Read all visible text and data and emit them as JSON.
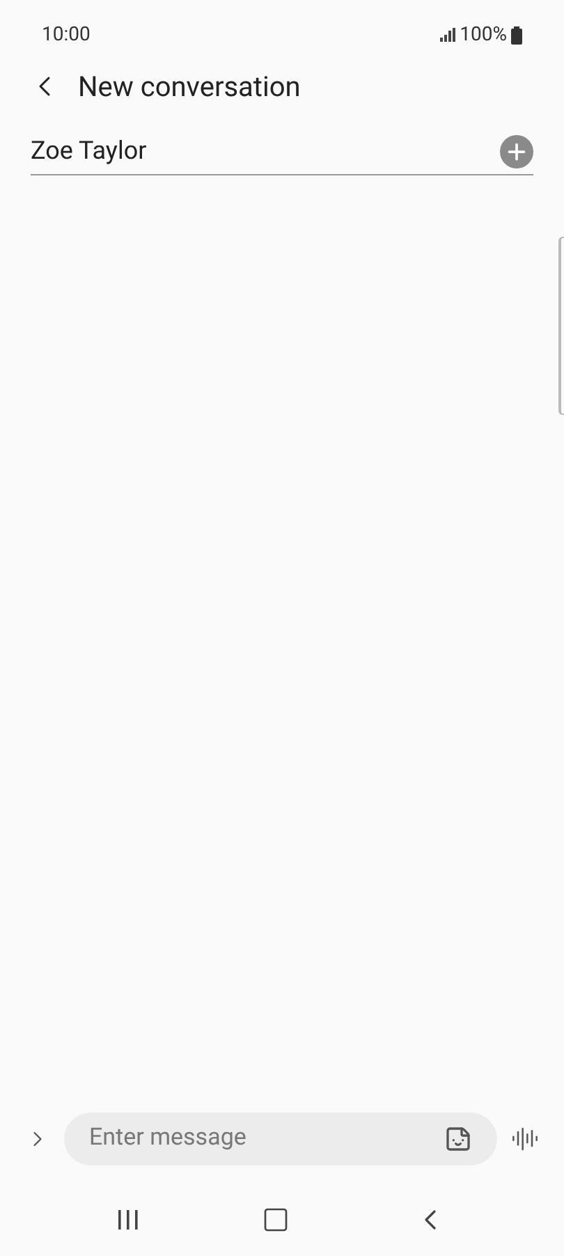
{
  "status_bar": {
    "time": "10:00",
    "battery": "100%"
  },
  "header": {
    "title": "New conversation"
  },
  "recipient": {
    "value": "Zoe Taylor"
  },
  "composer": {
    "placeholder": "Enter message"
  }
}
